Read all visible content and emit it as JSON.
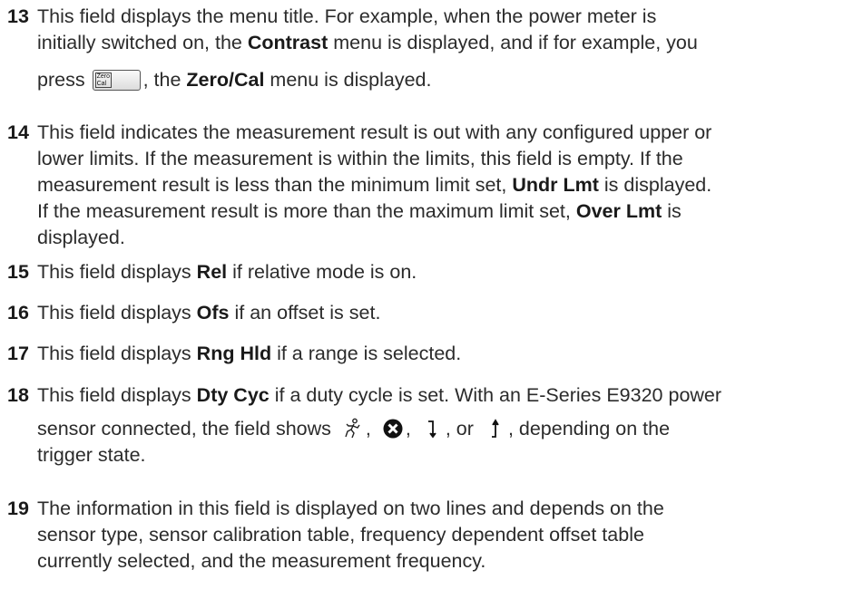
{
  "items": [
    {
      "number": "13",
      "lines": [
        "This field displays the menu title. For example, when the power meter is",
        "initially switched on, the",
        "menu is displayed, and if for example, you",
        "press",
        ", the",
        "menu is displayed."
      ],
      "bold": [
        "Contrast",
        "Zero/Cal"
      ],
      "key_label": "Zero\nCal"
    },
    {
      "number": "14",
      "lines": [
        "This field indicates the measurement result is out with any configured upper or",
        "lower limits. If the measurement is within the limits, this field is empty. If the",
        "measurement result is less than the minimum limit set,",
        "is displayed.",
        "If the measurement result is more than the maximum limit set,",
        "is",
        "displayed."
      ],
      "bold": [
        "Undr Lmt",
        "Over Lmt"
      ]
    },
    {
      "number": "15",
      "pre": "This field displays",
      "bold": "Rel",
      "post": "if relative mode is on."
    },
    {
      "number": "16",
      "pre": "This field displays",
      "bold": "Ofs",
      "post": "if an offset is set."
    },
    {
      "number": "17",
      "pre": "This field displays",
      "bold": "Rng Hld",
      "post": "if a range is selected."
    },
    {
      "number": "18",
      "pre": "This field displays",
      "bold": "Dty Cyc",
      "post": "if a duty cycle is set. With an E-Series E9320 power",
      "line2_pre": "sensor connected, the field shows",
      "sep1": ",",
      "sep2": ",",
      "sep3": ", or",
      "line2_post": ", depending on the",
      "line3": "trigger state.",
      "icons": [
        "running-man-icon",
        "stop-x-icon",
        "down-arrow-trigger-icon",
        "up-arrow-trigger-icon"
      ]
    },
    {
      "number": "19",
      "lines": [
        "The information in this field is displayed on two lines and depends on the",
        "sensor type, sensor calibration table, frequency dependent offset table",
        "currently selected, and the measurement frequency."
      ]
    }
  ]
}
